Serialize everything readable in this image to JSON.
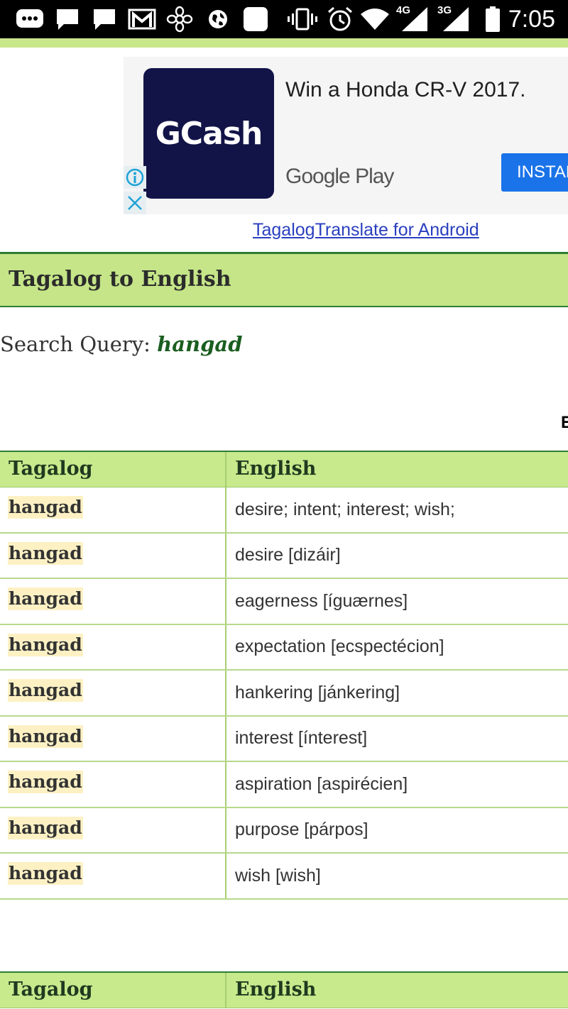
{
  "status_bar": {
    "time": "7:05",
    "net1": "4G",
    "net2": "3G",
    "icons": [
      "more-notifications-icon",
      "message-icon",
      "message-icon-2",
      "gmail-icon",
      "settings-flower-icon",
      "globe-icon",
      "blank-app-icon",
      "vibrate-icon",
      "alarm-icon",
      "wifi-icon",
      "signal-4g-icon",
      "signal-3g-icon",
      "battery-icon"
    ]
  },
  "ad": {
    "logo_text": "GCash",
    "title": "Win a Honda CR-V 2017.",
    "store": "Google Play",
    "install_label": "INSTALL"
  },
  "app_link": "TagalogTranslate for Android",
  "section": {
    "title": "Tagalog to English"
  },
  "search": {
    "label": "Search Query: ",
    "term": "hangad"
  },
  "cut_text": "E",
  "table": {
    "headers": [
      "Tagalog",
      "English"
    ],
    "rows": [
      {
        "tagalog": "hangad",
        "english": "desire; intent; interest; wish;"
      },
      {
        "tagalog": "hangad",
        "english": "desire [dizáir]"
      },
      {
        "tagalog": "hangad",
        "english": "eagerness [íguærnes]"
      },
      {
        "tagalog": "hangad",
        "english": "expectation [ecspectécion]"
      },
      {
        "tagalog": "hangad",
        "english": "hankering [jánkering]"
      },
      {
        "tagalog": "hangad",
        "english": "interest [ínterest]"
      },
      {
        "tagalog": "hangad",
        "english": "aspiration [aspirécien]"
      },
      {
        "tagalog": "hangad",
        "english": "purpose [párpos]"
      },
      {
        "tagalog": "hangad",
        "english": "wish [wish]"
      }
    ]
  },
  "table2": {
    "headers": [
      "Tagalog",
      "English"
    ]
  },
  "colors": {
    "header_green": "#c8e98c",
    "border_green": "#2e7d32",
    "word_highlight": "#fdf1c4",
    "ad_logo": "#121448",
    "install_blue": "#1a73e8"
  }
}
